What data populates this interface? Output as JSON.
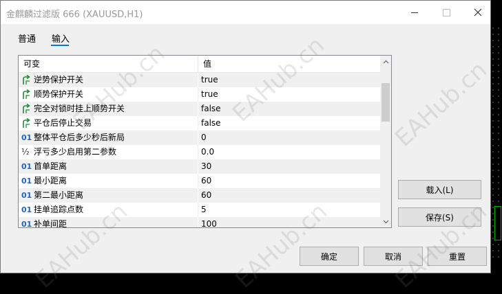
{
  "window": {
    "title": "金麒麟过滤版 666 (XAUUSD,H1)"
  },
  "tabs": [
    {
      "label": "普通",
      "active": false
    },
    {
      "label": "输入",
      "active": true
    }
  ],
  "grid": {
    "columns": {
      "variable": "可变",
      "value": "值"
    },
    "rows": [
      {
        "type": "bool",
        "name": "逆势保护开关",
        "value": "true"
      },
      {
        "type": "bool",
        "name": "顺势保护开关",
        "value": "true"
      },
      {
        "type": "bool",
        "name": "完全对锁时挂上顺势开关",
        "value": "false"
      },
      {
        "type": "bool",
        "name": "平仓后停止交易",
        "value": "false"
      },
      {
        "type": "int",
        "name": "整体平仓后多少秒后新局",
        "value": "0"
      },
      {
        "type": "double",
        "name": "浮亏多少启用第二参数",
        "value": "0.0"
      },
      {
        "type": "int",
        "name": "首单距离",
        "value": "30"
      },
      {
        "type": "int",
        "name": "最小距离",
        "value": "60"
      },
      {
        "type": "int",
        "name": "第二最小距离",
        "value": "60"
      },
      {
        "type": "int",
        "name": "挂单追踪点数",
        "value": "5"
      },
      {
        "type": "int",
        "name": "补单间距",
        "value": "100"
      }
    ],
    "type_icons": {
      "int": "01",
      "double": "½",
      "bool": "bool-arrow-icon"
    }
  },
  "side_buttons": {
    "load": "载入(L)",
    "save": "保存(S)"
  },
  "footer_buttons": {
    "ok": "确定",
    "cancel": "取消",
    "reset": "重置"
  },
  "watermark": "EAHub.cn",
  "colors": {
    "accent": "#0078d7",
    "icon_blue": "#2264b7",
    "bool_icon_green": "#1e8a3c",
    "row_alt": "#f0f0f0",
    "button_face": "#e1e1e1"
  }
}
